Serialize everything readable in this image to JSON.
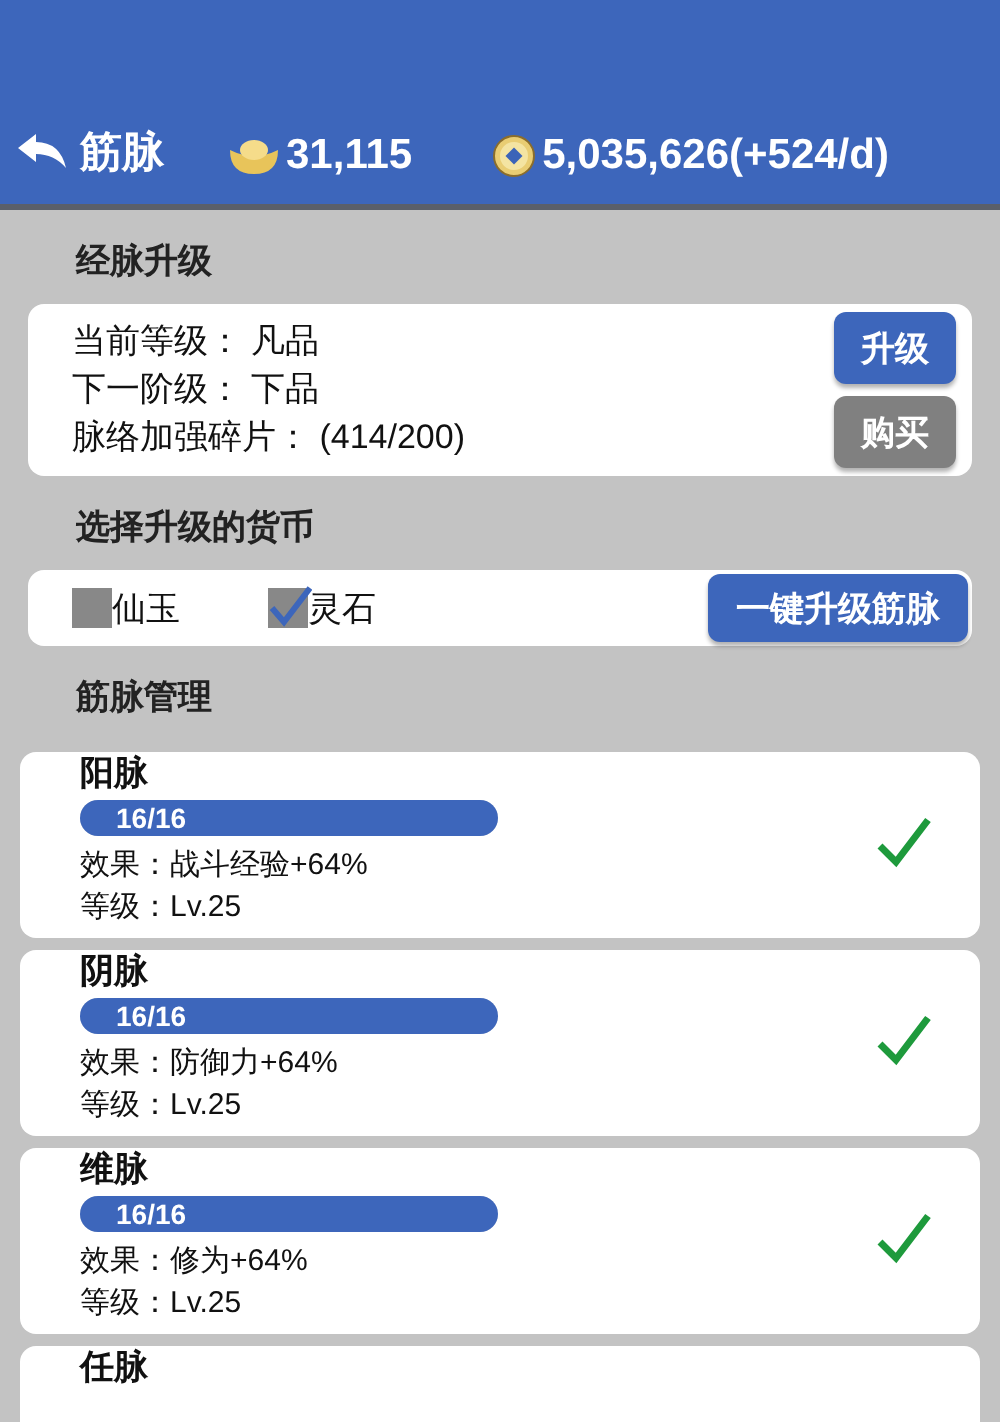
{
  "header": {
    "back": "筋脉",
    "currencies": [
      {
        "kind": "ingot",
        "amount": "31,115"
      },
      {
        "kind": "coin",
        "amount": "5,035,626(+524/d)"
      }
    ]
  },
  "upgrade": {
    "title": "经脉升级",
    "lines": [
      "当前等级： 凡品",
      "下一阶级： 下品",
      "脉络加强碎片： (414/200)"
    ],
    "buttons": [
      {
        "label": "升级",
        "disabled": false
      },
      {
        "label": "购买",
        "disabled": true
      }
    ]
  },
  "currency_select": {
    "title": "选择升级的货币",
    "options": [
      {
        "label": "仙玉",
        "checked": false
      },
      {
        "label": "灵石",
        "checked": true
      }
    ],
    "button": "一键升级筋脉"
  },
  "management": {
    "title": "筋脉管理",
    "meridians": [
      {
        "name": "阳脉",
        "progress": "16/16",
        "level": 1,
        "effect": "效果：战斗经验+64%",
        "grade": "等级：Lv.25",
        "completed": true
      },
      {
        "name": "阴脉",
        "progress": "16/16",
        "level": 1,
        "effect": "效果：防御力+64%",
        "grade": "等级：Lv.25",
        "completed": true
      },
      {
        "name": "维脉",
        "progress": "16/16",
        "level": 1,
        "effect": "效果：修为+64%",
        "grade": "等级：Lv.25",
        "completed": true
      },
      {
        "name": "任脉"
      }
    ]
  }
}
